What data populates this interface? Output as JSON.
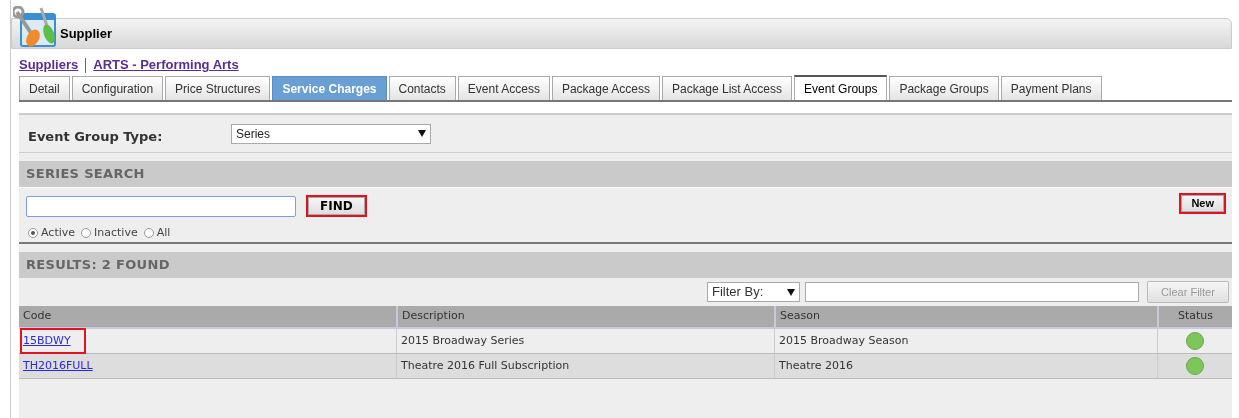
{
  "window": {
    "title": "Supplier"
  },
  "breadcrumb": [
    {
      "label": "Suppliers"
    },
    {
      "label": "ARTS - Performing Arts"
    }
  ],
  "tabs": [
    {
      "label": "Detail",
      "selected": false,
      "highlighted": false
    },
    {
      "label": "Configuration",
      "selected": false,
      "highlighted": false
    },
    {
      "label": "Price Structures",
      "selected": false,
      "highlighted": false
    },
    {
      "label": "Service Charges",
      "selected": false,
      "highlighted": true
    },
    {
      "label": "Contacts",
      "selected": false,
      "highlighted": false
    },
    {
      "label": "Event Access",
      "selected": false,
      "highlighted": false
    },
    {
      "label": "Package Access",
      "selected": false,
      "highlighted": false
    },
    {
      "label": "Package List Access",
      "selected": false,
      "highlighted": false
    },
    {
      "label": "Event Groups",
      "selected": true,
      "highlighted": false
    },
    {
      "label": "Package Groups",
      "selected": false,
      "highlighted": false
    },
    {
      "label": "Payment Plans",
      "selected": false,
      "highlighted": false
    }
  ],
  "event_group_type": {
    "label": "Event Group Type:",
    "value": "Series"
  },
  "search": {
    "title": "SERIES SEARCH",
    "find_button": {
      "label": "FIND",
      "outlined": true
    },
    "new_button": {
      "label": "New",
      "outlined": true
    },
    "radios": [
      {
        "label": "Active",
        "selected": true
      },
      {
        "label": "Inactive",
        "selected": false
      },
      {
        "label": "All",
        "selected": false
      }
    ]
  },
  "results": {
    "title": "RESULTS: 2 FOUND",
    "filter_by": "Filter By:",
    "clear_filter": "Clear Filter",
    "columns": [
      "Code",
      "Description",
      "Season",
      "Status"
    ],
    "rows": [
      {
        "code": "15BDWY",
        "outlined": true,
        "description": "2015 Broadway Series",
        "season": "2015 Broadway Season",
        "color": "#7cc65a"
      },
      {
        "code": "TH2016FULL",
        "outlined": false,
        "description": "Theatre 2016 Full Subscription",
        "season": "Theatre 2016",
        "color": "#7cc65a"
      }
    ]
  }
}
